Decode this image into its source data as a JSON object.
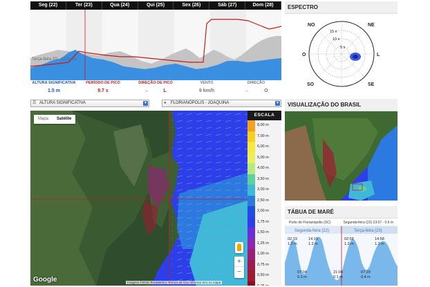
{
  "forecast": {
    "days": [
      "Seg (22)",
      "Ter (23)",
      "Qua (24)",
      "Qui (25)",
      "Sex (26)",
      "Sáb (27)",
      "Dom (28)"
    ],
    "note": "Terça-feira 20 - 12 horas",
    "legend_labels": [
      "ALTURA SIGNIFICATIVA",
      "PERÍODO DE PICO",
      "DIREÇÃO DE PICO",
      "VENTO",
      "DIREÇÃO"
    ],
    "legend_values": [
      "1.5 m",
      "9.7 s",
      "L",
      "9 km/h",
      "O"
    ],
    "colors": {
      "wave_fill": "#3b8fe0",
      "period_line": "#c41b1b",
      "swell_grey": "#c4c4c4"
    }
  },
  "selects": {
    "parameter": "ALTURA SIGNIFICATIVA",
    "location": "FLORIANÓPOLIS - JOAQUINA"
  },
  "map": {
    "type_options": [
      "Mapa",
      "Satélite"
    ],
    "active_type": "Satélite",
    "logo": "Google",
    "footer": "Imagens ©2016 TerraMetrics   Termos de Uso   Informar erro no mapa",
    "zoom_in": "+",
    "zoom_out": "−"
  },
  "scale": {
    "title": "ESCALA",
    "items": [
      {
        "label": "8,00 m",
        "color": "#f4a020"
      },
      {
        "label": "7,00 m",
        "color": "#f5d020"
      },
      {
        "label": "6,00 m",
        "color": "#f5e840"
      },
      {
        "label": "5,00 m",
        "color": "#e8f060"
      },
      {
        "label": "4,00 m",
        "color": "#b8e880"
      },
      {
        "label": "3,50 m",
        "color": "#60d0a0"
      },
      {
        "label": "3,00 m",
        "color": "#40b8d8"
      },
      {
        "label": "2,50 m",
        "color": "#2c7ae0"
      },
      {
        "label": "2,00 m",
        "color": "#1f4fe0"
      },
      {
        "label": "1,75 m",
        "color": "#2d3fe8"
      },
      {
        "label": "1,50 m",
        "color": "#6a2fd8"
      },
      {
        "label": "1,25 m",
        "color": "#8a2ab0"
      },
      {
        "label": "1,00 m",
        "color": "#9a1f7a"
      },
      {
        "label": "0,75 m",
        "color": "#a01a50"
      },
      {
        "label": "0,50 m",
        "color": "#a01a30"
      },
      {
        "label": "0,25 m",
        "color": "#8a1020"
      }
    ]
  },
  "espectro": {
    "title": "ESPECTRO",
    "directions": [
      "NO",
      "NE",
      "O",
      "L",
      "SO",
      "SE"
    ],
    "rings": [
      "15 s",
      "10 s",
      "5 s"
    ]
  },
  "brasil": {
    "title": "VISUALIZAÇÃO DO BRASIL"
  },
  "mare": {
    "title": "TÁBUA DE MARÉ",
    "port": "Porto de Florianópolis (SC)",
    "date": "Segunda-feira (22) 23:57 - 0.6 m",
    "days": [
      "Segunda-feira (22)",
      "Terça-feira (23)"
    ],
    "highs": [
      {
        "time": "02:19",
        "h": "1.2 m"
      },
      {
        "time": "14:19",
        "h": "1.2 m"
      },
      {
        "time": "02:58",
        "h": "1.2 m"
      },
      {
        "time": "14:58",
        "h": "1.2 m"
      }
    ],
    "lows": [
      {
        "time": "07:04",
        "h": "0.3 m"
      },
      {
        "time": "21:04",
        "h": "0.1 m"
      },
      {
        "time": "07:29",
        "h": "0.4 m"
      }
    ]
  }
}
